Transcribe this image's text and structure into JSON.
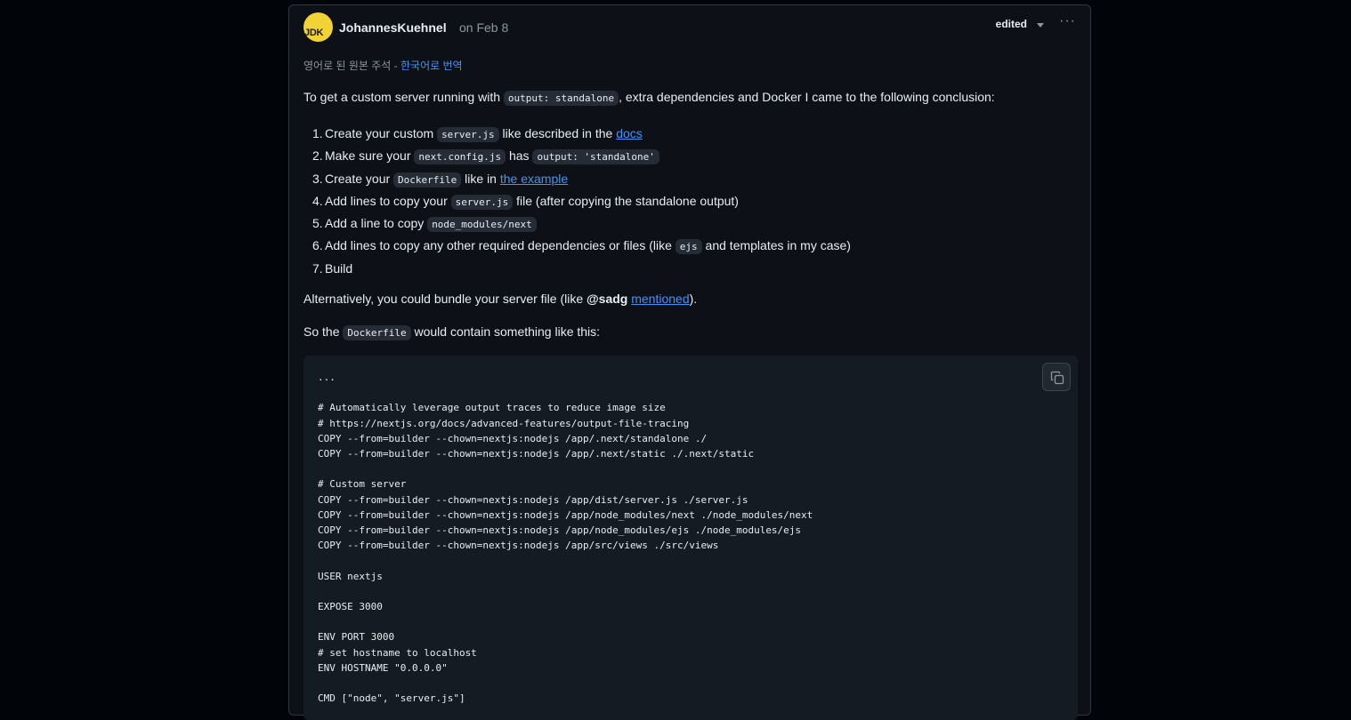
{
  "comment": {
    "author": "JohannesKuehnel",
    "avatar_initials": "JDK",
    "date": "on Feb 8",
    "edited_label": "edited",
    "more_label": "···",
    "translation_note": "영어로 된 원본 주석 - ",
    "translation_link": "한국어로 번역",
    "intro": {
      "before": "To get a custom server running with ",
      "code": "output: standalone",
      "after": ", extra dependencies and Docker I came to the following conclusion:"
    },
    "steps": [
      {
        "num": "1.",
        "a": "Create your custom ",
        "code": "server.js",
        "b": " like described in the ",
        "link": "docs"
      },
      {
        "num": "2.",
        "a": "Make sure your ",
        "code": "next.config.js",
        "b": " has ",
        "code2": "output: 'standalone'"
      },
      {
        "num": "3.",
        "a": "Create your ",
        "code": "Dockerfile",
        "b": " like in ",
        "link": "the example"
      },
      {
        "num": "4.",
        "a": "Add lines to copy your ",
        "code": "server.js",
        "b": " file (after copying the standalone output)"
      },
      {
        "num": "5.",
        "a": "Add a line to copy ",
        "code": "node_modules/next"
      },
      {
        "num": "6.",
        "a": "Add lines to copy any other required dependencies or files (like ",
        "code": "ejs",
        "b": " and templates in my case)"
      },
      {
        "num": "7.",
        "a": "Build"
      }
    ],
    "alt": {
      "before": "Alternatively, you could bundle your server file (like ",
      "mention": "@sadg",
      "space": " ",
      "link": "mentioned",
      "after": ")."
    },
    "so": {
      "before": "So the ",
      "code": "Dockerfile",
      "after": " would contain something like this:"
    },
    "code_block": "...\n\n# Automatically leverage output traces to reduce image size\n# https://nextjs.org/docs/advanced-features/output-file-tracing\nCOPY --from=builder --chown=nextjs:nodejs /app/.next/standalone ./\nCOPY --from=builder --chown=nextjs:nodejs /app/.next/static ./.next/static\n\n# Custom server\nCOPY --from=builder --chown=nextjs:nodejs /app/dist/server.js ./server.js\nCOPY --from=builder --chown=nextjs:nodejs /app/node_modules/next ./node_modules/next\nCOPY --from=builder --chown=nextjs:nodejs /app/node_modules/ejs ./node_modules/ejs\nCOPY --from=builder --chown=nextjs:nodejs /app/src/views ./src/views\n\nUSER nextjs\n\nEXPOSE 3000\n\nENV PORT 3000\n# set hostname to localhost\nENV HOSTNAME \"0.0.0.0\"\n\nCMD [\"node\", \"server.js\"]"
  },
  "icons": {
    "copy": "copy-icon",
    "caret": "chevron-down-icon",
    "more": "kebab-horizontal-icon"
  },
  "colors": {
    "background": "#010409",
    "card": "#0d1117",
    "code_bg": "#151b23",
    "link": "#4493f8",
    "avatar": "#f2d335"
  }
}
